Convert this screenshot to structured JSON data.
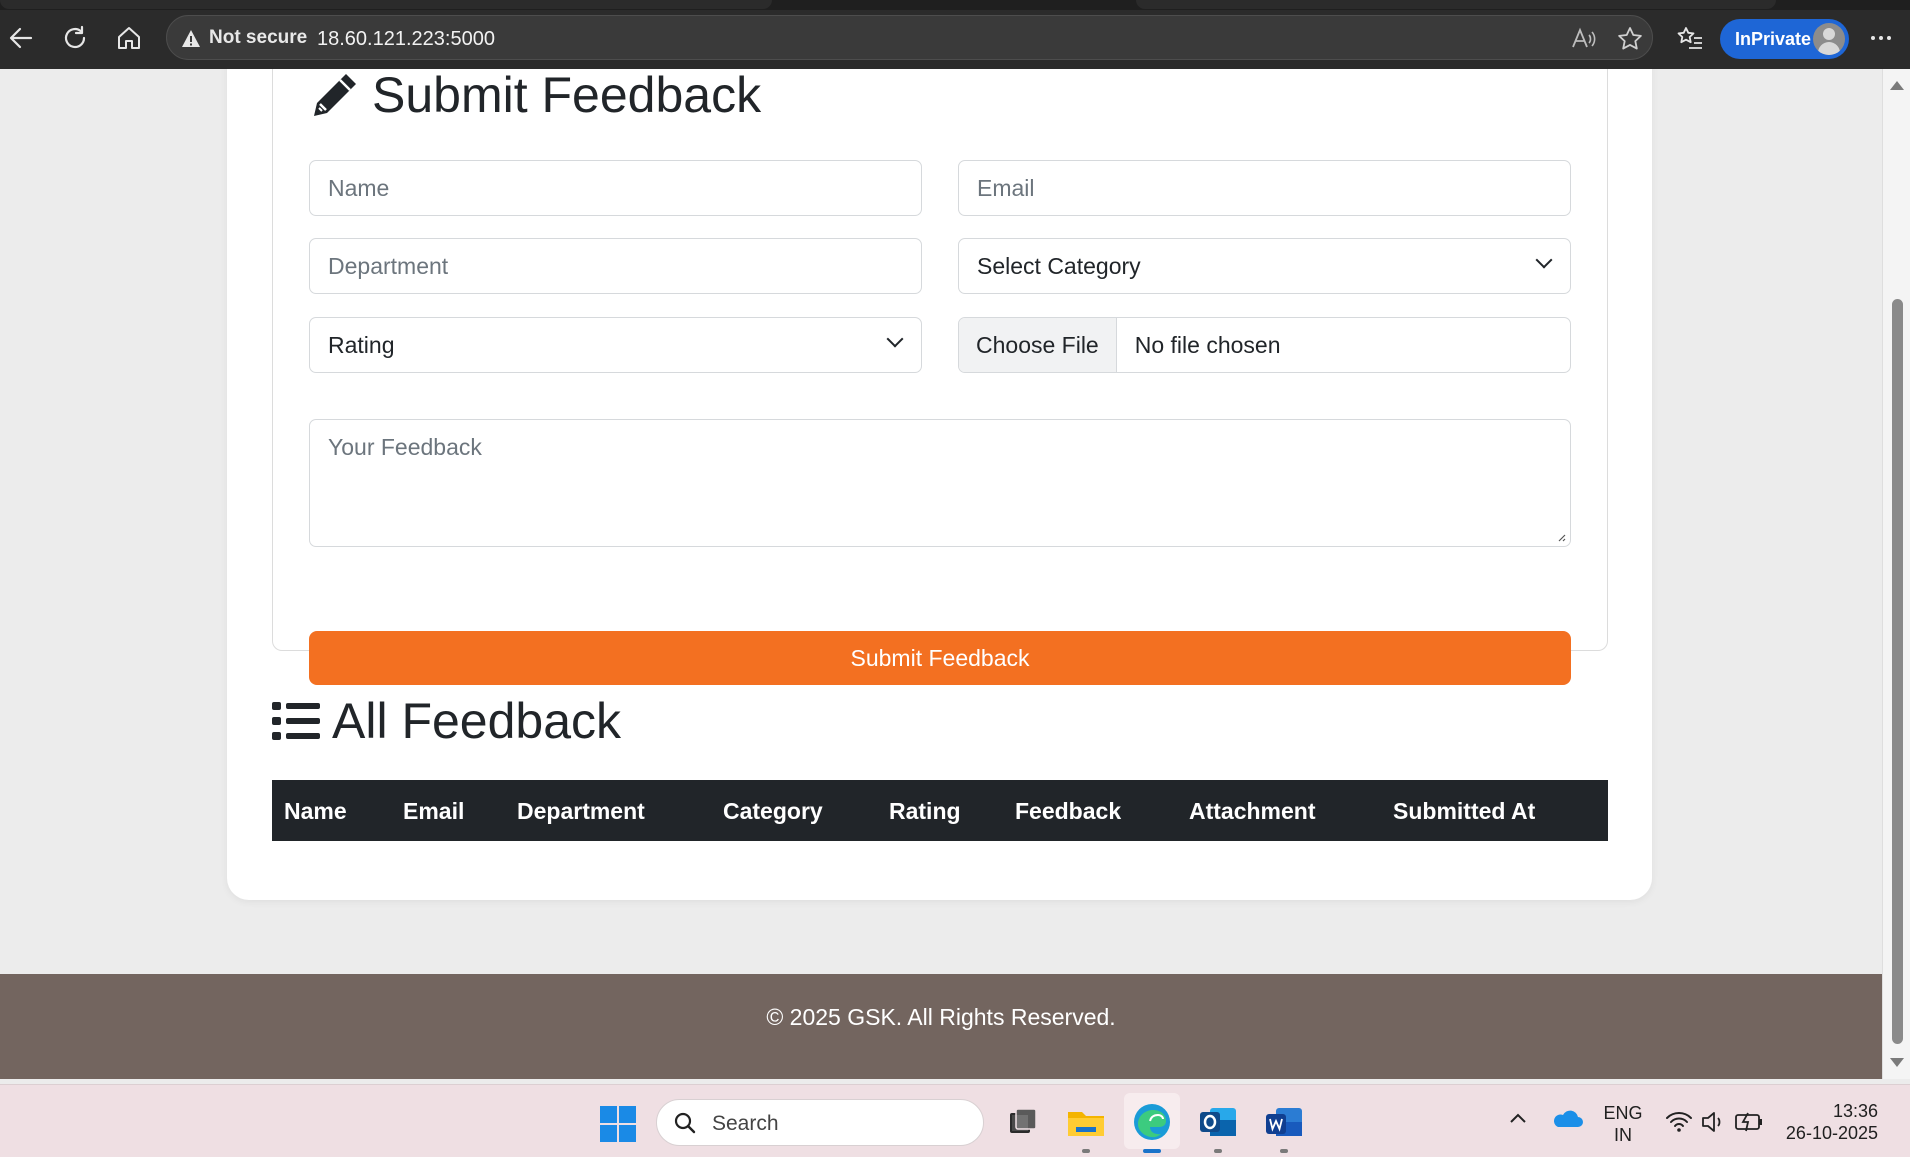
{
  "browser": {
    "security_label": "Not secure",
    "url": "18.60.121.223:5000",
    "profile_label": "InPrivate"
  },
  "form": {
    "title": "Submit Feedback",
    "name_placeholder": "Name",
    "email_placeholder": "Email",
    "department_placeholder": "Department",
    "category_select": "Select Category",
    "rating_select": "Rating",
    "file_button": "Choose File",
    "file_status": "No file chosen",
    "feedback_placeholder": "Your Feedback",
    "submit_label": "Submit Feedback"
  },
  "feedback_list": {
    "title": "All Feedback",
    "columns": [
      "Name",
      "Email",
      "Department",
      "Category",
      "Rating",
      "Feedback",
      "Attachment",
      "Submitted At"
    ],
    "rows": []
  },
  "footer": {
    "copyright": "© 2025 GSK. All Rights Reserved."
  },
  "taskbar": {
    "search_label": "Search",
    "language_line1": "ENG",
    "language_line2": "IN",
    "time": "13:36",
    "date": "26-10-2025"
  },
  "colors": {
    "accent": "#f37021",
    "table_header": "#212529",
    "footer_bg": "#73655f",
    "browser_profile": "#1e66d6"
  }
}
